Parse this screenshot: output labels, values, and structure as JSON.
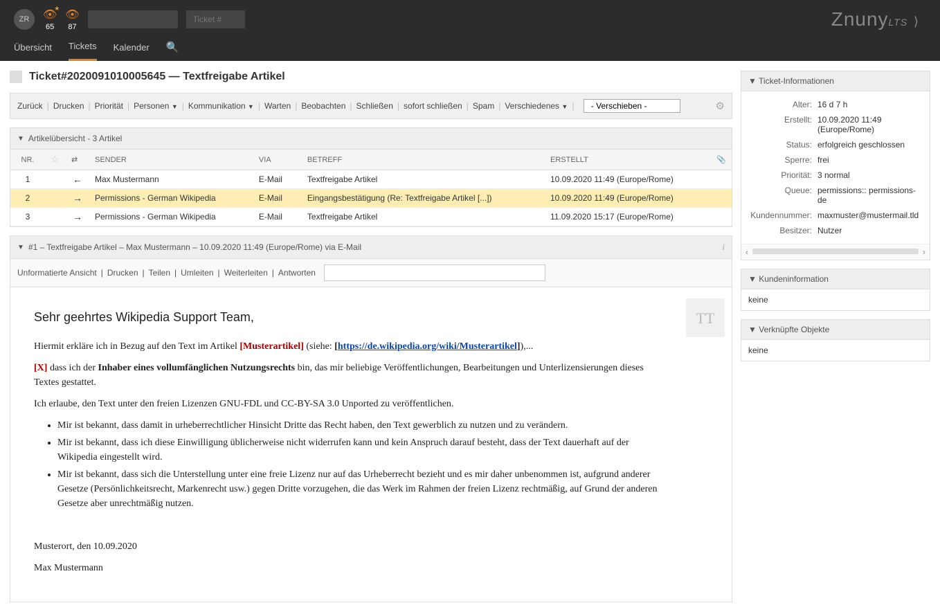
{
  "header": {
    "avatar": "ZR",
    "badges": [
      {
        "count": "65"
      },
      {
        "count": "87"
      }
    ],
    "searchTicketPlaceholder": "Ticket #",
    "logo": "Znuny",
    "logoSuffix": "LTS"
  },
  "nav": {
    "items": [
      "Übersicht",
      "Tickets",
      "Kalender"
    ],
    "activeIndex": 1
  },
  "ticket": {
    "title": "Ticket#2020091010005645 — Textfreigabe Artikel"
  },
  "actions": {
    "items": [
      "Zurück",
      "Drucken",
      "Priorität",
      "Personen",
      "Kommunikation",
      "Warten",
      "Beobachten",
      "Schließen",
      "sofort schließen",
      "Spam",
      "Verschiedenes"
    ],
    "dropdownFlags": [
      false,
      false,
      false,
      true,
      true,
      false,
      false,
      false,
      false,
      false,
      true
    ],
    "moveLabel": " - Verschieben - "
  },
  "articleOverview": {
    "title": "Artikelübersicht - 3 Artikel",
    "cols": [
      "NR.",
      "",
      "",
      "SENDER",
      "VIA",
      "BETREFF",
      "ERSTELLT",
      ""
    ],
    "rows": [
      {
        "nr": "1",
        "dir": "←",
        "sender": "Max Mustermann",
        "via": "E-Mail",
        "subject": "Textfreigabe Artikel",
        "created": "10.09.2020 11:49 (Europe/Rome)"
      },
      {
        "nr": "2",
        "dir": "→",
        "sender": "Permissions - German Wikipedia",
        "via": "E-Mail",
        "subject": "Eingangsbestätigung (Re: Textfreigabe Artikel [...])",
        "created": "10.09.2020 11:49 (Europe/Rome)"
      },
      {
        "nr": "3",
        "dir": "→",
        "sender": "Permissions - German Wikipedia",
        "via": "E-Mail",
        "subject": "Textfreigabe Artikel",
        "created": "11.09.2020 15:17 (Europe/Rome)"
      }
    ],
    "selectedIndex": 1
  },
  "articleDetail": {
    "header": "#1 – Textfreigabe Artikel – Max Mustermann – 10.09.2020 11:49 (Europe/Rome) via E-Mail",
    "subActions": [
      "Unformatierte Ansicht",
      "Drucken",
      "Teilen",
      "Umleiten",
      "Weiterleiten",
      "Antworten"
    ],
    "avatar": "TT",
    "body": {
      "greeting": "Sehr geehrtes Wikipedia Support Team,",
      "intro1": "Hiermit erkläre ich in Bezug auf den Text im Artikel ",
      "articleName": "[Musterartikel]",
      "siehe": " (siehe: ",
      "linkOpen": "[",
      "linkUrl": "https://de.wikipedia.org/wiki/Musterartikel",
      "linkClose": "]",
      "introEnd": "),...",
      "xmark": "[X]",
      "dass1": " dass ich der ",
      "inhaber": "Inhaber eines vollumfänglichen Nutzungsrechts",
      "dass2": " bin, das mir beliebige Veröffentlichungen, Bearbeitungen und Unterlizensierungen dieses Textes gestattet.",
      "allow": "Ich erlaube, den Text unter den freien Lizenzen GNU-FDL und CC-BY-SA 3.0 Unported zu veröffentlichen.",
      "bullets": [
        "Mir ist bekannt, dass damit in urheberrechtlicher Hinsicht Dritte das Recht haben, den Text gewerblich zu nutzen und zu verändern.",
        "Mir ist bekannt, dass ich diese Einwilligung üblicherweise nicht widerrufen kann und kein Anspruch darauf besteht, dass der Text dauerhaft auf der Wikipedia eingestellt wird.",
        "Mir ist bekannt, dass sich die Unterstellung unter eine freie Lizenz nur auf das Urheberrecht bezieht und es mir daher unbenommen ist, aufgrund anderer Gesetze (Persönlichkeitsrecht, Markenrecht usw.) gegen Dritte vorzugehen, die das Werk im Rahmen der freien Lizenz rechtmäßig, auf Grund der anderen Gesetze aber unrechtmäßig nutzen."
      ],
      "place": "Musterort, den 10.09.2020",
      "name": "Max Mustermann"
    }
  },
  "sidebar": {
    "ticketInfo": {
      "title": "Ticket-Informationen",
      "rows": [
        {
          "label": "Alter:",
          "value": "16 d 7 h"
        },
        {
          "label": "Erstellt:",
          "value": "10.09.2020 11:49 (Europe/Rome)"
        },
        {
          "label": "Status:",
          "value": "erfolgreich geschlossen"
        },
        {
          "label": "Sperre:",
          "value": "frei"
        },
        {
          "label": "Priorität:",
          "value": "3 normal"
        },
        {
          "label": "Queue:",
          "value": "permissions:: permissions-de"
        },
        {
          "label": "Kundennummer:",
          "value": "maxmuster@mustermail.tld"
        },
        {
          "label": "Besitzer:",
          "value": "Nutzer"
        }
      ]
    },
    "customerInfo": {
      "title": "Kundeninformation",
      "value": "keine"
    },
    "linkedObjects": {
      "title": "Verknüpfte Objekte",
      "value": "keine"
    }
  }
}
